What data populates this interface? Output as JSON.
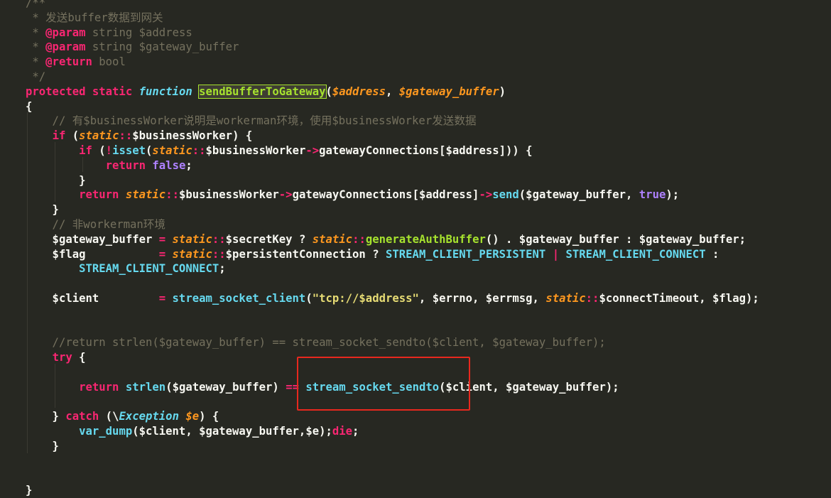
{
  "code_lines": [
    {
      "tokens": [
        {
          "text": "/**",
          "cls": "c-cmt"
        }
      ]
    },
    {
      "tokens": [
        {
          "text": " * 发送buffer数据到网关",
          "cls": "c-cmt"
        }
      ]
    },
    {
      "tokens": [
        {
          "text": " * ",
          "cls": "c-cmt"
        },
        {
          "text": "@param",
          "cls": "c-doctag"
        },
        {
          "text": " string $address",
          "cls": "c-cmt"
        }
      ]
    },
    {
      "tokens": [
        {
          "text": " * ",
          "cls": "c-cmt"
        },
        {
          "text": "@param",
          "cls": "c-doctag"
        },
        {
          "text": " string $gateway_buffer",
          "cls": "c-cmt"
        }
      ]
    },
    {
      "tokens": [
        {
          "text": " * ",
          "cls": "c-cmt"
        },
        {
          "text": "@return",
          "cls": "c-doctag"
        },
        {
          "text": " bool",
          "cls": "c-cmt"
        }
      ]
    },
    {
      "tokens": [
        {
          "text": " */",
          "cls": "c-cmt"
        }
      ]
    },
    {
      "tokens": [
        {
          "text": "protected static ",
          "cls": "c-kw"
        },
        {
          "text": "function",
          "cls": "c-sto"
        },
        {
          "text": " ",
          "cls": "c-plain"
        },
        {
          "text": "sendBufferToGateway",
          "cls": "c-ftag"
        },
        {
          "text": "(",
          "cls": "c-plain"
        },
        {
          "text": "$address",
          "cls": "c-it"
        },
        {
          "text": ", ",
          "cls": "c-plain"
        },
        {
          "text": "$gateway_buffer",
          "cls": "c-it"
        },
        {
          "text": ")",
          "cls": "c-plain"
        }
      ]
    },
    {
      "tokens": [
        {
          "text": "{",
          "cls": "c-plain"
        }
      ]
    },
    {
      "tokens": [
        {
          "text": "    // 有$businessWorker说明是workerman环境，使用$businessWorker发送数据",
          "cls": "c-cmt"
        }
      ]
    },
    {
      "tokens": [
        {
          "text": "    ",
          "cls": "c-plain"
        },
        {
          "text": "if",
          "cls": "c-kw"
        },
        {
          "text": " (",
          "cls": "c-plain"
        },
        {
          "text": "static",
          "cls": "c-it"
        },
        {
          "text": "::",
          "cls": "c-op"
        },
        {
          "text": "$businessWorker) {",
          "cls": "c-plain"
        }
      ]
    },
    {
      "tokens": [
        {
          "text": "        ",
          "cls": "c-plain"
        },
        {
          "text": "if",
          "cls": "c-kw"
        },
        {
          "text": " (",
          "cls": "c-plain"
        },
        {
          "text": "!",
          "cls": "c-op"
        },
        {
          "text": "isset",
          "cls": "c-call"
        },
        {
          "text": "(",
          "cls": "c-plain"
        },
        {
          "text": "static",
          "cls": "c-it"
        },
        {
          "text": "::",
          "cls": "c-op"
        },
        {
          "text": "$businessWorker",
          "cls": "c-plain"
        },
        {
          "text": "->",
          "cls": "c-op"
        },
        {
          "text": "gatewayConnections[$address])) {",
          "cls": "c-plain"
        }
      ]
    },
    {
      "tokens": [
        {
          "text": "            ",
          "cls": "c-plain"
        },
        {
          "text": "return",
          "cls": "c-kw"
        },
        {
          "text": " ",
          "cls": "c-plain"
        },
        {
          "text": "false",
          "cls": "c-bool"
        },
        {
          "text": ";",
          "cls": "c-plain"
        }
      ]
    },
    {
      "tokens": [
        {
          "text": "        }",
          "cls": "c-plain"
        }
      ]
    },
    {
      "tokens": [
        {
          "text": "        ",
          "cls": "c-plain"
        },
        {
          "text": "return",
          "cls": "c-kw"
        },
        {
          "text": " ",
          "cls": "c-plain"
        },
        {
          "text": "static",
          "cls": "c-it"
        },
        {
          "text": "::",
          "cls": "c-op"
        },
        {
          "text": "$businessWorker",
          "cls": "c-plain"
        },
        {
          "text": "->",
          "cls": "c-op"
        },
        {
          "text": "gatewayConnections[$address]",
          "cls": "c-plain"
        },
        {
          "text": "->",
          "cls": "c-op"
        },
        {
          "text": "send",
          "cls": "c-call"
        },
        {
          "text": "($gateway_buffer, ",
          "cls": "c-plain"
        },
        {
          "text": "true",
          "cls": "c-bool"
        },
        {
          "text": ");",
          "cls": "c-plain"
        }
      ]
    },
    {
      "tokens": [
        {
          "text": "    }",
          "cls": "c-plain"
        }
      ]
    },
    {
      "tokens": [
        {
          "text": "    // 非workerman环境",
          "cls": "c-cmt"
        }
      ]
    },
    {
      "tokens": [
        {
          "text": "    $gateway_buffer ",
          "cls": "c-plain"
        },
        {
          "text": "=",
          "cls": "c-op"
        },
        {
          "text": " ",
          "cls": "c-plain"
        },
        {
          "text": "static",
          "cls": "c-it"
        },
        {
          "text": "::",
          "cls": "c-op"
        },
        {
          "text": "$secretKey ? ",
          "cls": "c-plain"
        },
        {
          "text": "static",
          "cls": "c-it"
        },
        {
          "text": "::",
          "cls": "c-op"
        },
        {
          "text": "generateAuthBuffer",
          "cls": "c-fn"
        },
        {
          "text": "() . $gateway_buffer : $gateway_buffer;",
          "cls": "c-plain"
        }
      ]
    },
    {
      "tokens": [
        {
          "text": "    $flag           ",
          "cls": "c-plain"
        },
        {
          "text": "=",
          "cls": "c-op"
        },
        {
          "text": " ",
          "cls": "c-plain"
        },
        {
          "text": "static",
          "cls": "c-it"
        },
        {
          "text": "::",
          "cls": "c-op"
        },
        {
          "text": "$persistentConnection ? ",
          "cls": "c-plain"
        },
        {
          "text": "STREAM_CLIENT_PERSISTENT",
          "cls": "c-const"
        },
        {
          "text": " ",
          "cls": "c-plain"
        },
        {
          "text": "|",
          "cls": "c-op"
        },
        {
          "text": " ",
          "cls": "c-plain"
        },
        {
          "text": "STREAM_CLIENT_CONNECT",
          "cls": "c-const"
        },
        {
          "text": " :",
          "cls": "c-plain"
        }
      ]
    },
    {
      "tokens": [
        {
          "text": "        ",
          "cls": "c-plain"
        },
        {
          "text": "STREAM_CLIENT_CONNECT",
          "cls": "c-const"
        },
        {
          "text": ";",
          "cls": "c-plain"
        }
      ]
    },
    {
      "tokens": []
    },
    {
      "tokens": [
        {
          "text": "    $client         ",
          "cls": "c-plain"
        },
        {
          "text": "=",
          "cls": "c-op"
        },
        {
          "text": " ",
          "cls": "c-plain"
        },
        {
          "text": "stream_socket_client",
          "cls": "c-call"
        },
        {
          "text": "(",
          "cls": "c-plain"
        },
        {
          "text": "\"tcp://$address\"",
          "cls": "c-str"
        },
        {
          "text": ", $errno, $errmsg, ",
          "cls": "c-plain"
        },
        {
          "text": "static",
          "cls": "c-it"
        },
        {
          "text": "::",
          "cls": "c-op"
        },
        {
          "text": "$connectTimeout, $flag);",
          "cls": "c-plain"
        }
      ]
    },
    {
      "tokens": []
    },
    {
      "tokens": []
    },
    {
      "tokens": [
        {
          "text": "    //return strlen($gateway_buffer) == stream_socket_sendto($client, $gateway_buffer);",
          "cls": "c-cmt"
        }
      ]
    },
    {
      "tokens": [
        {
          "text": "    ",
          "cls": "c-plain"
        },
        {
          "text": "try",
          "cls": "c-kw"
        },
        {
          "text": " {",
          "cls": "c-plain"
        }
      ]
    },
    {
      "tokens": []
    },
    {
      "tokens": [
        {
          "text": "        ",
          "cls": "c-plain"
        },
        {
          "text": "return",
          "cls": "c-kw"
        },
        {
          "text": " ",
          "cls": "c-plain"
        },
        {
          "text": "strlen",
          "cls": "c-call"
        },
        {
          "text": "($gateway_buffer) ",
          "cls": "c-plain"
        },
        {
          "text": "==",
          "cls": "c-op"
        },
        {
          "text": " ",
          "cls": "c-plain"
        },
        {
          "text": "stream_socket_sendto",
          "cls": "c-call"
        },
        {
          "text": "($client, $gateway_buffer);",
          "cls": "c-plain"
        }
      ]
    },
    {
      "tokens": []
    },
    {
      "tokens": [
        {
          "text": "    } ",
          "cls": "c-plain"
        },
        {
          "text": "catch",
          "cls": "c-kw"
        },
        {
          "text": " (\\",
          "cls": "c-plain"
        },
        {
          "text": "Exception",
          "cls": "c-ex"
        },
        {
          "text": " ",
          "cls": "c-plain"
        },
        {
          "text": "$e",
          "cls": "c-it"
        },
        {
          "text": ") {",
          "cls": "c-plain"
        }
      ]
    },
    {
      "tokens": [
        {
          "text": "        ",
          "cls": "c-plain"
        },
        {
          "text": "var_dump",
          "cls": "c-call"
        },
        {
          "text": "($client, $gateway_buffer,$e);",
          "cls": "c-plain"
        },
        {
          "text": "die",
          "cls": "c-kw"
        },
        {
          "text": ";",
          "cls": "c-plain"
        }
      ]
    },
    {
      "tokens": [
        {
          "text": "    }",
          "cls": "c-plain"
        }
      ]
    },
    {
      "tokens": []
    },
    {
      "tokens": []
    },
    {
      "tokens": [
        {
          "text": "}",
          "cls": "c-plain"
        }
      ]
    }
  ],
  "annotation": {
    "color": "#e8281e"
  }
}
